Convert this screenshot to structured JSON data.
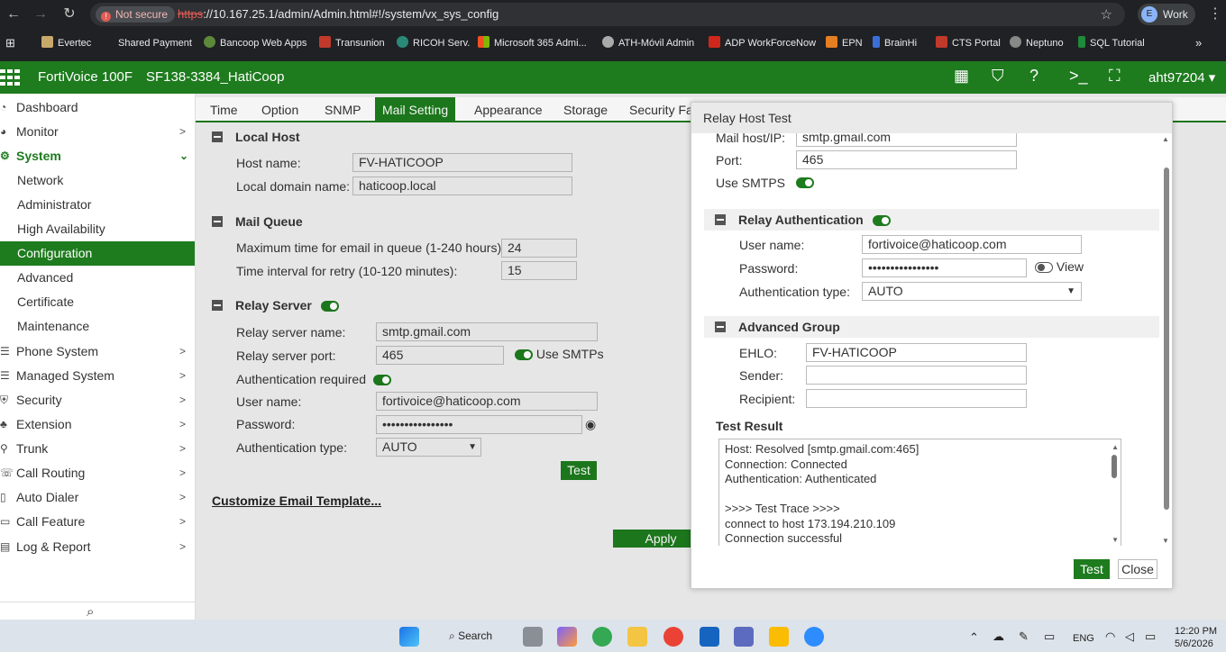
{
  "browser": {
    "security_label": "Not secure",
    "url_scheme": "https",
    "url_rest": "://10.167.25.1/admin/Admin.html#!/system/vx_sys_config",
    "profile_initial": "E",
    "profile_name": "Work",
    "bookmarks": [
      "Evertec",
      "Shared Payment",
      "Bancoop Web Apps",
      "Transunion",
      "RICOH Serv.",
      "Microsoft 365 Admi...",
      "ATH-Móvil Admin",
      "ADP WorkForceNow",
      "EPN",
      "BrainHi",
      "CTS Portal",
      "Neptuno",
      "SQL Tutorial"
    ]
  },
  "app": {
    "title": "FortiVoice 100F",
    "hostname": "SF138-3384_HatiCoop",
    "user": "aht97204"
  },
  "sidebar": {
    "items": [
      {
        "label": "Dashboard"
      },
      {
        "label": "Monitor"
      },
      {
        "label": "System"
      },
      {
        "label": "Network"
      },
      {
        "label": "Administrator"
      },
      {
        "label": "High Availability"
      },
      {
        "label": "Configuration"
      },
      {
        "label": "Advanced"
      },
      {
        "label": "Certificate"
      },
      {
        "label": "Maintenance"
      },
      {
        "label": "Phone System"
      },
      {
        "label": "Managed System"
      },
      {
        "label": "Security"
      },
      {
        "label": "Extension"
      },
      {
        "label": "Trunk"
      },
      {
        "label": "Call Routing"
      },
      {
        "label": "Auto Dialer"
      },
      {
        "label": "Call Feature"
      },
      {
        "label": "Log & Report"
      }
    ]
  },
  "tabs": [
    "Time",
    "Option",
    "SNMP",
    "Mail Setting",
    "Appearance",
    "Storage",
    "Security Fal"
  ],
  "mail": {
    "local_host": {
      "title": "Local Host",
      "host_name_label": "Host name:",
      "host_name": "FV-HATICOOP",
      "domain_label": "Local domain name:",
      "domain": "haticoop.local"
    },
    "queue": {
      "title": "Mail Queue",
      "max_label": "Maximum time for email in queue (1-240 hours):",
      "max": "24",
      "retry_label": "Time interval for retry (10-120 minutes):",
      "retry": "15"
    },
    "relay": {
      "title": "Relay Server",
      "name_label": "Relay server name:",
      "name": "smtp.gmail.com",
      "port_label": "Relay server port:",
      "port": "465",
      "smtps_label": "Use SMTPs",
      "auth_label": "Authentication required",
      "user_label": "User name:",
      "user": "fortivoice@haticoop.com",
      "pass_label": "Password:",
      "pass": "••••••••••••••••",
      "authtype_label": "Authentication type:",
      "authtype": "AUTO",
      "test_label": "Test"
    },
    "template_link": "Customize Email Template...",
    "apply_label": "Apply"
  },
  "modal": {
    "title": "Relay Host Test",
    "mailhost_label": "Mail host/IP:",
    "mailhost": "smtp.gmail.com",
    "port_label": "Port:",
    "port": "465",
    "smtps_label": "Use SMTPS",
    "auth_title": "Relay Authentication",
    "user_label": "User name:",
    "user": "fortivoice@haticoop.com",
    "pass_label": "Password:",
    "pass": "••••••••••••••••",
    "view_label": "View",
    "authtype_label": "Authentication type:",
    "authtype": "AUTO",
    "adv_title": "Advanced Group",
    "ehlo_label": "EHLO:",
    "ehlo": "FV-HATICOOP",
    "sender_label": "Sender:",
    "sender": "",
    "recipient_label": "Recipient:",
    "recipient": "",
    "result_title": "Test Result",
    "result_lines": [
      "Host: Resolved [smtp.gmail.com:465]",
      "Connection: Connected",
      "Authentication: Authenticated",
      "",
      ">>>> Test Trace >>>>",
      "connect to host 173.194.210.109",
      "Connection successful"
    ],
    "test_label": "Test",
    "close_label": "Close"
  },
  "taskbar": {
    "search_label": "Search",
    "lang": "ENG",
    "time": "12:20 PM",
    "date": "5/6/2026"
  }
}
